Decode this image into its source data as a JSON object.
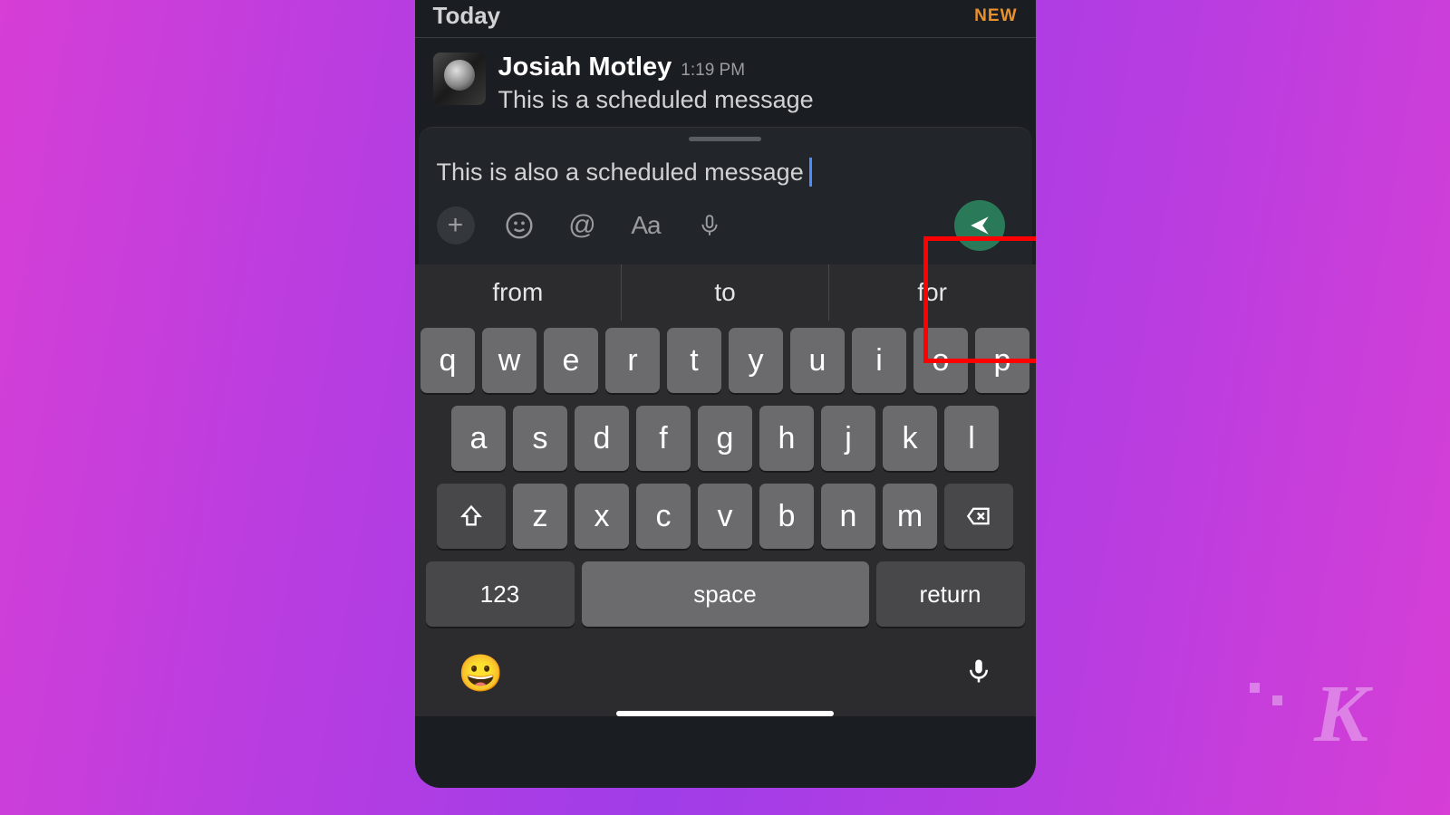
{
  "header": {
    "date_label": "Today",
    "new_badge": "NEW"
  },
  "message": {
    "username": "Josiah Motley",
    "timestamp": "1:19 PM",
    "text": "This is a scheduled message"
  },
  "composer": {
    "draft_text": "This is also a scheduled message",
    "toolbar": {
      "plus": "+",
      "at": "@",
      "aa": "Aa"
    }
  },
  "keyboard": {
    "suggestions": [
      "from",
      "to",
      "for"
    ],
    "row1": [
      "q",
      "w",
      "e",
      "r",
      "t",
      "y",
      "u",
      "i",
      "o",
      "p"
    ],
    "row2": [
      "a",
      "s",
      "d",
      "f",
      "g",
      "h",
      "j",
      "k",
      "l"
    ],
    "row3": [
      "z",
      "x",
      "c",
      "v",
      "b",
      "n",
      "m"
    ],
    "num_key": "123",
    "space_key": "space",
    "return_key": "return"
  },
  "watermark": "K"
}
